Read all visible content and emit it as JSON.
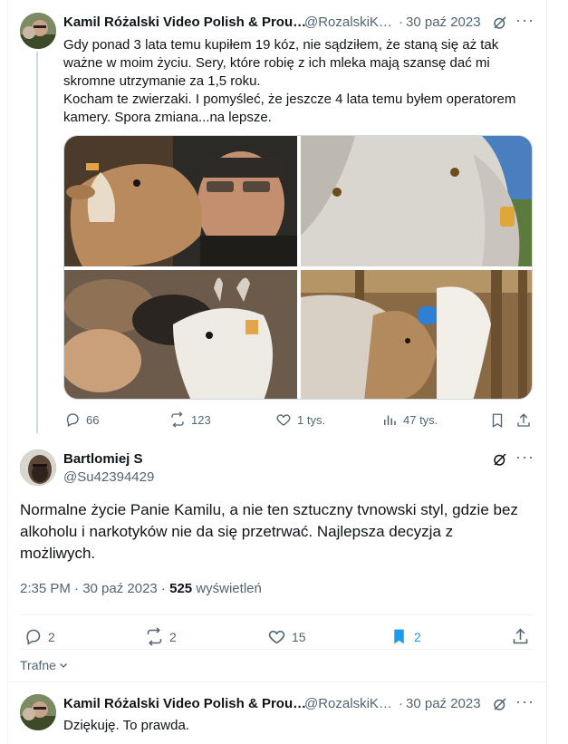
{
  "tweet1": {
    "author_name": "Kamil Różalski Video Polish & Prou…",
    "handle": "@RozalskiK…",
    "dot": "·",
    "date": "30 paź 2023",
    "text_lines": [
      "Gdy ponad 3 lata temu kupiłem 19 kóz, nie sądziłem, że staną się aż tak",
      "ważne w moim życiu. Sery, które robię z ich mleka mają szansę dać mi",
      "skromne utrzymanie za 1,5 roku.",
      "Kocham te zwierzaki. I pomyśleć, że jeszcze 4 lata temu byłem operatorem",
      "kamery. Spora zmiana...na lepsze."
    ],
    "replies": "66",
    "reposts": "123",
    "likes": "1 tys.",
    "views": "47 tys."
  },
  "tweet2": {
    "author_name": "Bartlomiej S",
    "handle": "@Su42394429",
    "text_lines": [
      "Normalne życie Panie Kamilu, a nie ten sztuczny tvnowski styl, gdzie bez",
      "alkoholu i narkotyków nie da się przetrwać. Najlepsza decyzja z",
      "możliwych."
    ],
    "timestamp": "2:35 PM · 30 paź 2023 ·",
    "views_count": "525",
    "views_label": "wyświetleń",
    "replies": "2",
    "reposts": "2",
    "likes": "15",
    "bookmarks": "2"
  },
  "sort": {
    "label": "Trafne"
  },
  "tweet3": {
    "author_name": "Kamil Różalski Video Polish & Prou…",
    "handle": "@RozalskiK…",
    "dot": "·",
    "date": "30 paź 2023",
    "text": "Dziękuję. To prawda."
  },
  "colors": {
    "accent": "#1d9bf0",
    "muted": "#536471",
    "border": "#eff3f4"
  }
}
